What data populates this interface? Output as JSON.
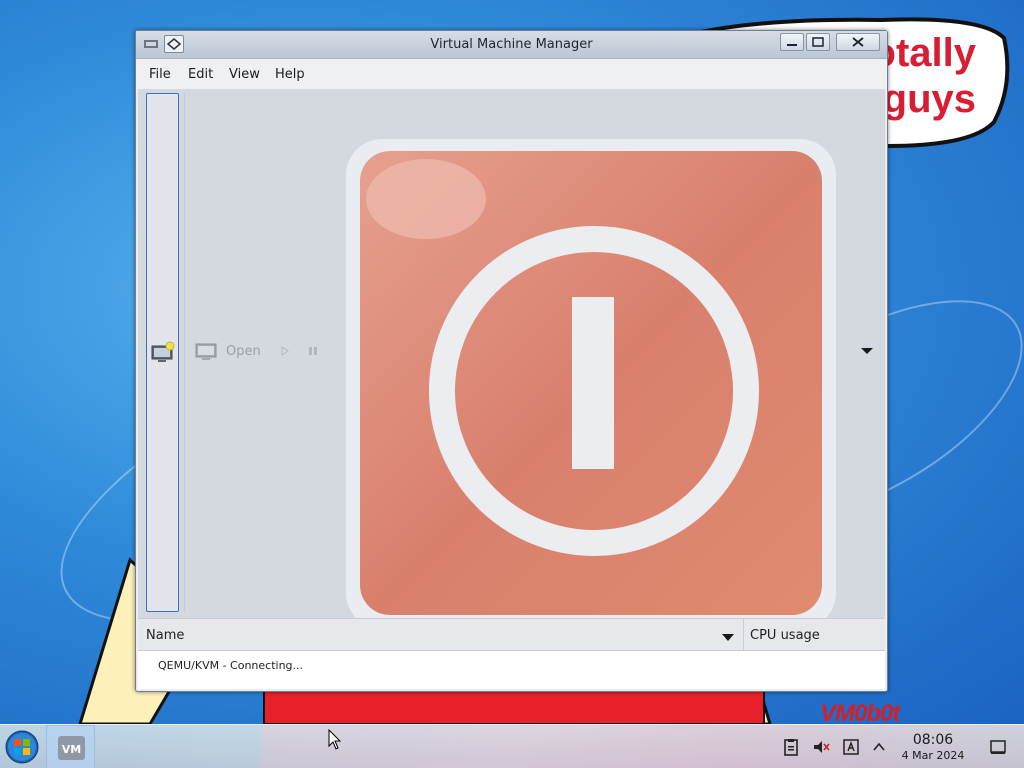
{
  "desktop": {
    "bubble_text_line1": "this is totally",
    "bubble_text_line2": "guys",
    "wall_signature": "VM0b0t"
  },
  "window": {
    "title": "Virtual Machine Manager",
    "menu": {
      "file": "File",
      "edit": "Edit",
      "view": "View",
      "help": "Help"
    },
    "toolbar": {
      "open_label": "Open"
    },
    "list": {
      "columns": [
        "Name",
        "CPU usage"
      ],
      "rows": [
        {
          "name": "QEMU/KVM - Connecting..."
        }
      ]
    }
  },
  "taskbar": {
    "clock_time": "08:06",
    "clock_date": "4 Mar 2024",
    "app_label": "VM"
  },
  "colors": {
    "error_red": "#d9705c",
    "accent_blue": "#3d6fd3",
    "bubble_text": "#d81e34"
  }
}
